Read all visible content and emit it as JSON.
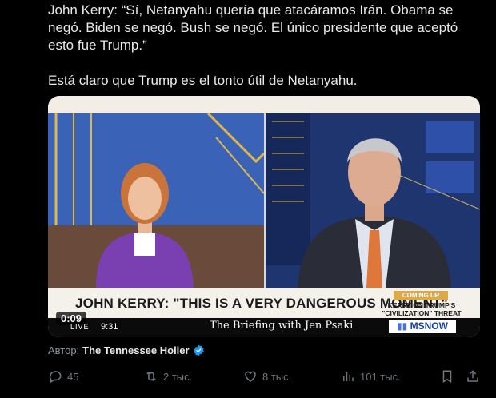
{
  "tweet": {
    "line1": "John Kerry: “Sí, Netanyahu quería que atacáramos Irán. Obama se negó. Biden se negó. Bush se negó. El único presidente que aceptó esto fue Trump.”",
    "line2": "Está claro que Trump es el tonto útil de Netanyahu."
  },
  "video": {
    "headline": "JOHN KERRY: \"THIS IS A VERY DANGEROUS MOMENT\"",
    "coming_up_label": "COMING UP",
    "coming_up_text": "KERRY ON TRUMP'S \"CIVILIZATION\" THREAT",
    "duration": "0:09",
    "live_label": "LIVE",
    "clock": "9:31",
    "show_title": "The Briefing with Jen Psaki",
    "network": "MSNOW"
  },
  "author": {
    "prefix": "Автор:",
    "name": "The Tennessee Holler"
  },
  "actions": {
    "replies": "45",
    "reposts": "2 тыс.",
    "likes": "8 тыс.",
    "views": "101 тыс."
  },
  "colors": {
    "background": "#000000",
    "text": "#e7e9ea",
    "muted": "#71767b",
    "verified": "#1d9bf0"
  }
}
